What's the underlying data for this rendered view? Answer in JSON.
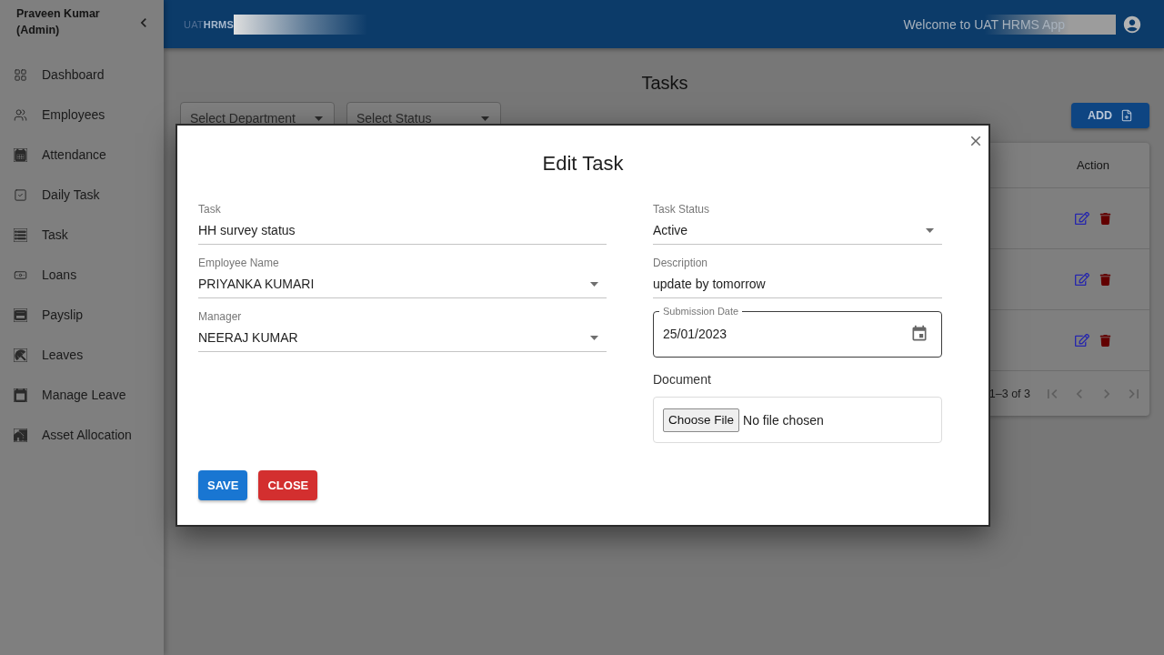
{
  "sidebar": {
    "user": "Praveen Kumar (Admin)",
    "items": [
      "Dashboard",
      "Employees",
      "Attendance",
      "Daily Task",
      "Task",
      "Loans",
      "Payslip",
      "Leaves",
      "Manage Leave",
      "Asset Allocation"
    ]
  },
  "header": {
    "logo": "UAT**HRMS**",
    "welcome": "Welcome to UAT HRMS App"
  },
  "page": {
    "title": "Tasks",
    "filters": [
      {
        "placeholder": "Select Department"
      },
      {
        "placeholder": "Select Status"
      }
    ],
    "add_button": "ADD",
    "table": {
      "columns": [
        "Action"
      ],
      "rows": [
        {
          "editable": true,
          "deletable": true
        },
        {
          "editable": true,
          "deletable": true
        },
        {
          "editable": true,
          "deletable": true
        }
      ],
      "pagination": {
        "range": "1–3 of 3",
        "buttons": [
          {
            "disabled": true
          },
          {
            "disabled": true
          },
          {
            "disabled": true
          },
          {
            "disabled": true
          }
        ]
      }
    }
  },
  "dialog": {
    "title": "Edit Task",
    "left_fields": [
      {
        "kind": "text",
        "label": "Task",
        "value": "HH survey status"
      },
      {
        "kind": "select",
        "label": "Employee Name",
        "value": "PRIYANKA KUMARI"
      },
      {
        "kind": "select",
        "label": "Manager",
        "value": "NEERAJ KUMAR"
      }
    ],
    "right_fields": [
      {
        "kind": "select",
        "label": "Task Status",
        "value": "Active"
      },
      {
        "kind": "text",
        "label": "Description",
        "value": "update by tomorrow"
      },
      {
        "kind": "date",
        "label": "Submission Date",
        "value": "25/01/2023"
      },
      {
        "kind": "file",
        "label": "Document",
        "button": "Choose File",
        "status": "No file chosen"
      }
    ],
    "buttons": [
      {
        "kind": "primary",
        "label": "SAVE"
      },
      {
        "kind": "danger",
        "label": "CLOSE"
      }
    ]
  }
}
